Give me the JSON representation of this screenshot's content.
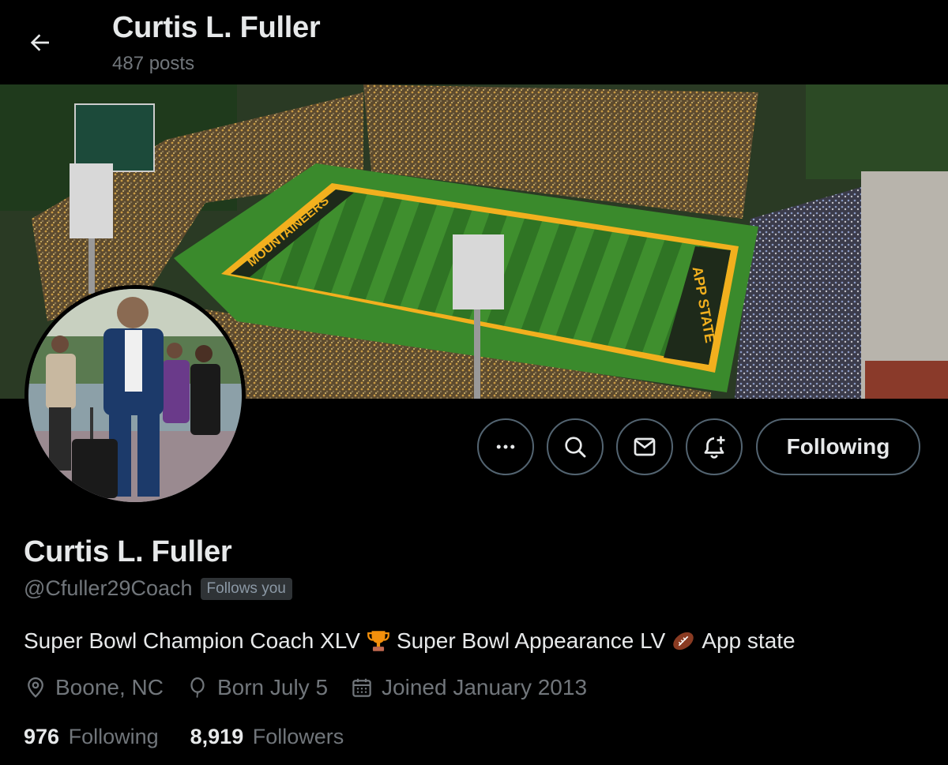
{
  "header": {
    "title": "Curtis L. Fuller",
    "posts": "487 posts"
  },
  "banner": {
    "field_end_left": "MOUNTAINEERS",
    "field_end_right": "APP STATE"
  },
  "actions": {
    "more_icon": "more-icon",
    "search_icon": "search-icon",
    "message_icon": "message-icon",
    "notify_icon": "notification-bell-icon",
    "following_label": "Following"
  },
  "profile": {
    "name": "Curtis L. Fuller",
    "handle": "@Cfuller29Coach",
    "follows_you": "Follows you",
    "bio": {
      "part1": "Super Bowl Champion Coach XLV",
      "part2": "Super Bowl Appearance LV",
      "part3": "App state"
    },
    "location": "Boone, NC",
    "birthday": "Born July 5",
    "joined": "Joined January 2013",
    "following_count": "976",
    "following_label": "Following",
    "followers_count": "8,919",
    "followers_label": "Followers"
  },
  "colors": {
    "background": "#000000",
    "text": "#e7e9ea",
    "muted": "#71767b",
    "border": "#536471",
    "field_gold": "#f2b01e"
  }
}
